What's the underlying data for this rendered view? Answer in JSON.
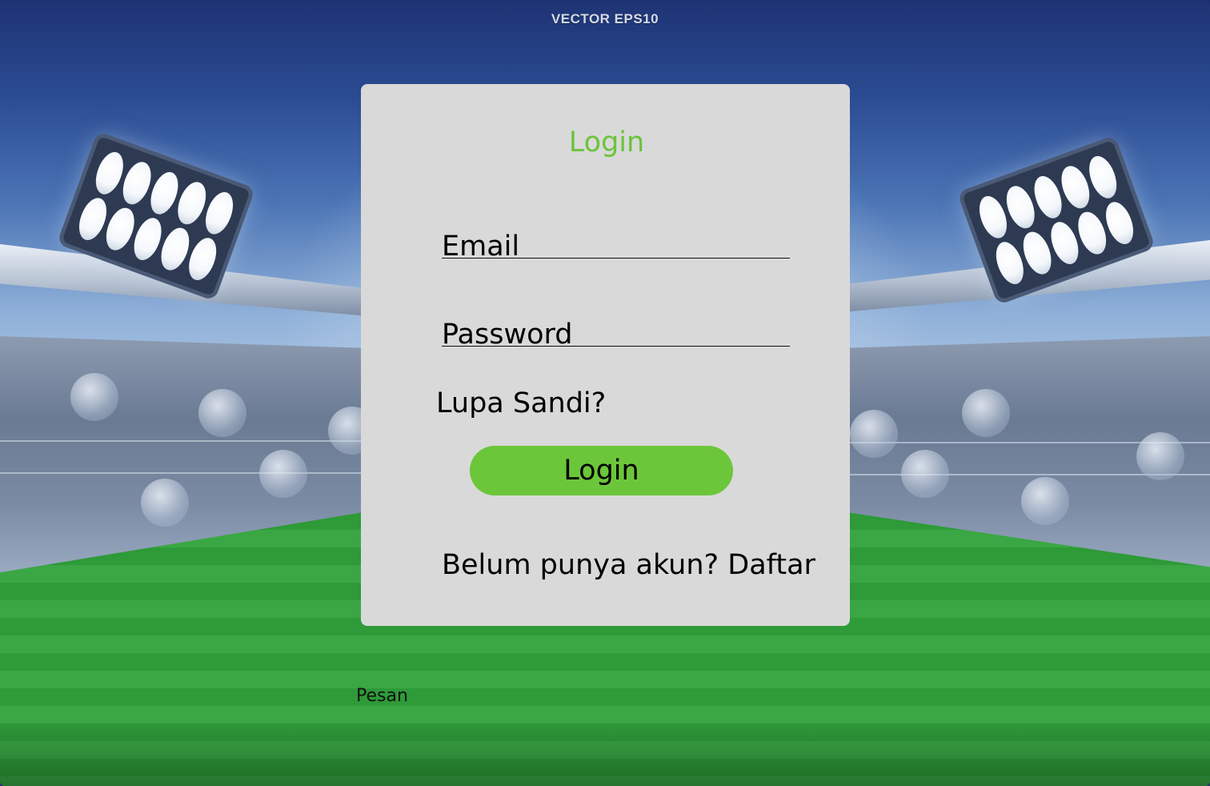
{
  "background": {
    "watermark": "VECTOR EPS10"
  },
  "login_card": {
    "title": "Login",
    "email_label": "Email",
    "password_label": "Password",
    "forgot_password": "Lupa Sandi?",
    "login_button": "Login",
    "signup_prompt": "Belum punya akun? Daftar"
  },
  "footer": {
    "message_label": "Pesan"
  },
  "colors": {
    "accent_green": "#6cc63a",
    "title_green": "#6bc43a",
    "card_background": "#d9d9d9"
  }
}
